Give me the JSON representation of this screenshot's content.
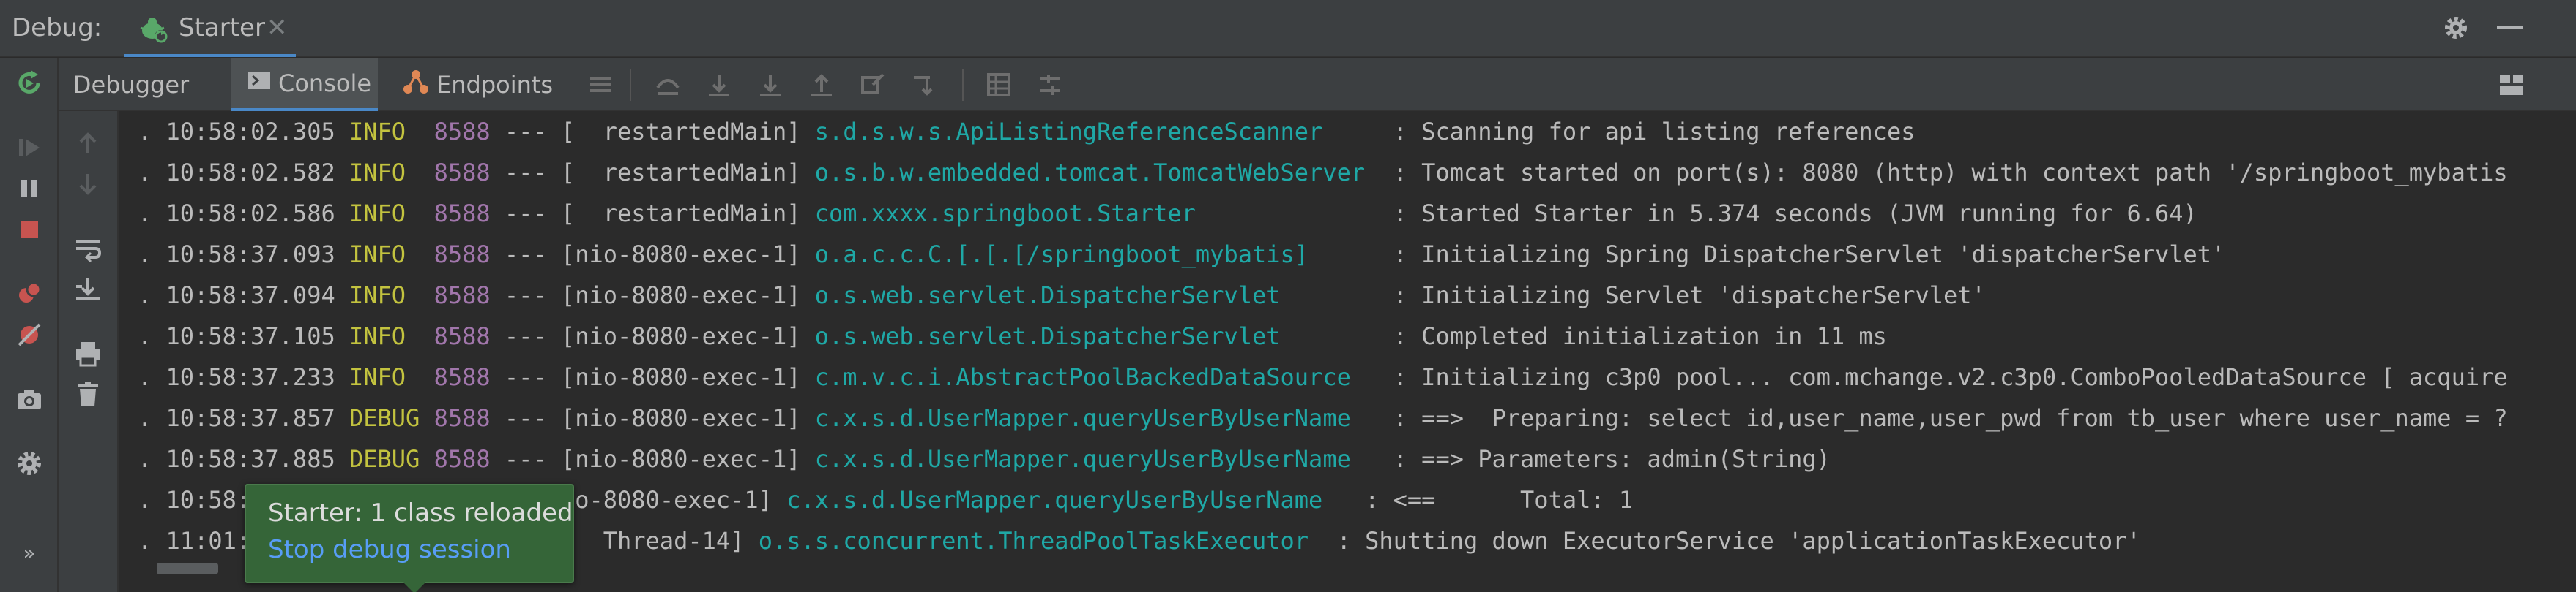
{
  "titlebar": {
    "debug_label": "Debug:",
    "run_tab_name": "Starter",
    "close_glyph": "✕"
  },
  "toolbar": {
    "tabs": [
      {
        "label": "Debugger"
      },
      {
        "label": "Console"
      },
      {
        "label": "Endpoints"
      }
    ],
    "active_tab": "Console"
  },
  "console": {
    "lines": [
      {
        "prefix": ". ",
        "time": "10:58:02.305",
        "level": "INFO ",
        "pid": "8588",
        "sep": " --- [  restartedMain] ",
        "logger": "s.d.s.w.s.ApiListingReferenceScanner    ",
        "message": " : Scanning for api listing references"
      },
      {
        "prefix": ". ",
        "time": "10:58:02.582",
        "level": "INFO ",
        "pid": "8588",
        "sep": " --- [  restartedMain] ",
        "logger": "o.s.b.w.embedded.tomcat.TomcatWebServer ",
        "message": " : Tomcat started on port(s): 8080 (http) with context path '/springboot_mybatis"
      },
      {
        "prefix": ". ",
        "time": "10:58:02.586",
        "level": "INFO ",
        "pid": "8588",
        "sep": " --- [  restartedMain] ",
        "logger": "com.xxxx.springboot.Starter             ",
        "message": " : Started Starter in 5.374 seconds (JVM running for 6.64)"
      },
      {
        "prefix": ". ",
        "time": "10:58:37.093",
        "level": "INFO ",
        "pid": "8588",
        "sep": " --- [nio-8080-exec-1] ",
        "logger": "o.a.c.c.C.[.[.[/springboot_mybatis]     ",
        "message": " : Initializing Spring DispatcherServlet 'dispatcherServlet'"
      },
      {
        "prefix": ". ",
        "time": "10:58:37.094",
        "level": "INFO ",
        "pid": "8588",
        "sep": " --- [nio-8080-exec-1] ",
        "logger": "o.s.web.servlet.DispatcherServlet       ",
        "message": " : Initializing Servlet 'dispatcherServlet'"
      },
      {
        "prefix": ". ",
        "time": "10:58:37.105",
        "level": "INFO ",
        "pid": "8588",
        "sep": " --- [nio-8080-exec-1] ",
        "logger": "o.s.web.servlet.DispatcherServlet       ",
        "message": " : Completed initialization in 11 ms"
      },
      {
        "prefix": ". ",
        "time": "10:58:37.233",
        "level": "INFO ",
        "pid": "8588",
        "sep": " --- [nio-8080-exec-1] ",
        "logger": "c.m.v.c.i.AbstractPoolBackedDataSource  ",
        "message": " : Initializing c3p0 pool... com.mchange.v2.c3p0.ComboPooledDataSource [ acquire"
      },
      {
        "prefix": ". ",
        "time": "10:58:37.857",
        "level": "DEBUG",
        "pid": "8588",
        "sep": " --- [nio-8080-exec-1] ",
        "logger": "c.x.s.d.UserMapper.queryUserByUserName  ",
        "message": " : ==>  Preparing: select id,user_name,user_pwd from tb_user where user_name = ?"
      },
      {
        "prefix": ". ",
        "time": "10:58:37.885",
        "level": "DEBUG",
        "pid": "8588",
        "sep": " --- [nio-8080-exec-1] ",
        "logger": "c.x.s.d.UserMapper.queryUserByUserName  ",
        "message": " : ==> Parameters: admin(String)"
      },
      {
        "prefix": ". ",
        "time": "10:58:",
        "level": "",
        "pid": "",
        "sep": "                     nio-8080-exec-1] ",
        "logger": "c.x.s.d.UserMapper.queryUserByUserName  ",
        "message": " : <==      Total: 1"
      },
      {
        "prefix": ". ",
        "time": "11:01:",
        "level": "",
        "pid": "",
        "sep": "                         Thread-14] ",
        "logger": "o.s.s.concurrent.ThreadPoolTaskExecutor ",
        "message": " : Shutting down ExecutorService 'applicationTaskExecutor'"
      }
    ]
  },
  "balloon": {
    "title": "Starter: 1 class reloaded",
    "link": "Stop debug session"
  },
  "colors": {
    "accent": "#4a88c7",
    "log_level": "#c3c33f",
    "pid": "#a176ab",
    "logger": "#1fa8a6",
    "balloon_bg": "#356538",
    "link": "#589df6"
  },
  "icons": {
    "titlebar": [
      "bug-icon",
      "gear-icon",
      "minimize-icon"
    ],
    "left_toolbar": [
      "rerun-icon",
      "resume-icon",
      "pause-icon",
      "stop-icon",
      "view-breakpoints-icon",
      "mute-breakpoints-icon",
      "camera-icon",
      "settings-icon",
      "more-icon"
    ],
    "toolbar": [
      "console-icon",
      "endpoints-icon",
      "menu-icon",
      "show-execution-point-icon",
      "step-over-icon",
      "step-into-icon",
      "step-out-icon",
      "run-to-cursor-icon",
      "evaluate-icon",
      "frames-icon",
      "threads-icon",
      "layout-icon"
    ],
    "console_tools": [
      "up-icon",
      "down-icon",
      "soft-wrap-icon",
      "scroll-to-end-icon",
      "print-icon",
      "clear-icon"
    ]
  }
}
